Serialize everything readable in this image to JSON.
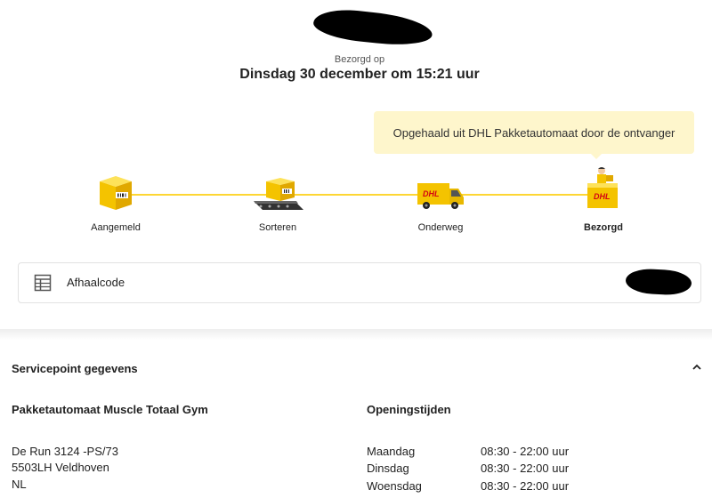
{
  "status": {
    "delivered_label": "Bezorgd op",
    "delivered_date": "Dinsdag 30 december om 15:21 uur",
    "tooltip": "Opgehaald uit DHL Pakketautomaat door de ontvanger"
  },
  "steps": [
    {
      "label": "Aangemeld",
      "icon": "package-registered-icon"
    },
    {
      "label": "Sorteren",
      "icon": "sorting-conveyor-icon"
    },
    {
      "label": "Onderweg",
      "icon": "delivery-van-icon"
    },
    {
      "label": "Bezorgd",
      "icon": "delivered-courier-icon",
      "active": true
    }
  ],
  "pickup": {
    "label": "Afhaalcode",
    "icon": "grid-table-icon"
  },
  "servicepoint": {
    "title": "Servicepoint gegevens",
    "name": "Pakketautomaat Muscle Totaal Gym",
    "address": [
      "De Run 3124 -PS/73",
      "5503LH Veldhoven",
      "NL"
    ],
    "hours_title": "Openingstijden",
    "hours": [
      {
        "day": "Maandag",
        "time": "08:30 - 22:00 uur"
      },
      {
        "day": "Dinsdag",
        "time": "08:30 - 22:00 uur"
      },
      {
        "day": "Woensdag",
        "time": "08:30 - 22:00 uur"
      }
    ]
  },
  "colors": {
    "dhl_yellow": "#fdd634",
    "dhl_red": "#d40511",
    "tooltip_bg": "#fef6cc"
  }
}
